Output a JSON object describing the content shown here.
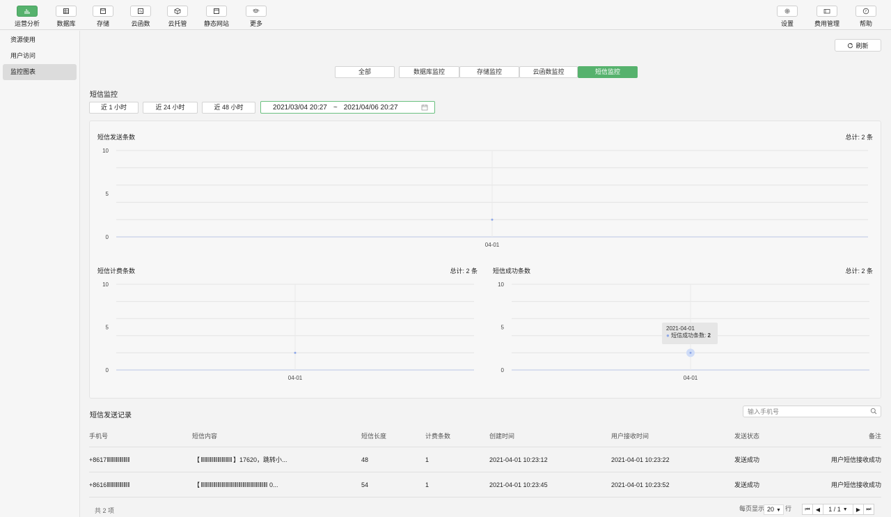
{
  "toolbar": {
    "left": [
      {
        "label": "运营分析",
        "icon": "bar-chart-icon",
        "active": true
      },
      {
        "label": "数据库",
        "icon": "database-icon"
      },
      {
        "label": "存储",
        "icon": "save-icon"
      },
      {
        "label": "云函数",
        "icon": "function-icon"
      },
      {
        "label": "云托管",
        "icon": "cube-icon"
      },
      {
        "label": "静态网站",
        "icon": "browser-icon"
      },
      {
        "label": "更多",
        "icon": "layers-icon"
      }
    ],
    "right": [
      {
        "label": "设置",
        "icon": "gear-icon"
      },
      {
        "label": "费用管理",
        "icon": "wallet-icon"
      },
      {
        "label": "帮助",
        "icon": "help-icon"
      }
    ]
  },
  "sidebar": {
    "items": [
      {
        "label": "资源使用"
      },
      {
        "label": "用户访问"
      },
      {
        "label": "监控图表",
        "active": true
      }
    ]
  },
  "refresh_label": "刷新",
  "tabs": [
    "全部",
    "数据库监控",
    "存储监控",
    "云函数监控",
    "短信监控"
  ],
  "active_tab": "短信监控",
  "section_title": "短信监控",
  "ranges": [
    "近 1 小时",
    "近 24 小时",
    "近 48 小时"
  ],
  "date_range": {
    "start": "2021/03/04 20:27",
    "sep": "~",
    "end": "2021/04/06 20:27"
  },
  "charts": [
    {
      "title": "短信发送条数",
      "total": "总计: 2 条"
    },
    {
      "title": "短信计费条数",
      "total": "总计: 2 条"
    },
    {
      "title": "短信成功条数",
      "total": "总计: 2 条"
    }
  ],
  "chart_data": [
    {
      "type": "line",
      "title": "短信发送条数",
      "x": [
        "04-01"
      ],
      "series": [
        {
          "values": [
            2
          ]
        }
      ],
      "ylim": [
        0,
        10
      ],
      "yticks": [
        0,
        5,
        10
      ],
      "grid": true
    },
    {
      "type": "line",
      "title": "短信计费条数",
      "x": [
        "04-01"
      ],
      "series": [
        {
          "values": [
            2
          ]
        }
      ],
      "ylim": [
        0,
        10
      ],
      "yticks": [
        0,
        5,
        10
      ],
      "grid": true
    },
    {
      "type": "line",
      "title": "短信成功条数",
      "x": [
        "04-01"
      ],
      "series": [
        {
          "name": "短信成功条数",
          "values": [
            2
          ]
        }
      ],
      "ylim": [
        0,
        10
      ],
      "yticks": [
        0,
        5,
        10
      ],
      "grid": true
    }
  ],
  "tooltip": {
    "date": "2021-04-01",
    "label": "短信成功条数: ",
    "value": "2"
  },
  "records_title": "短信发送记录",
  "search_placeholder": "输入手机号",
  "table": {
    "headers": [
      "手机号",
      "短信内容",
      "短信长度",
      "计费条数",
      "创建时间",
      "用户接收时间",
      "发送状态",
      "备注"
    ],
    "rows": [
      {
        "phone": "+8617",
        "content_pre": "【",
        "content_post": "】17620，跳转小...",
        "length": "48",
        "billed": "1",
        "created": "2021-04-01 10:23:12",
        "received": "2021-04-01 10:23:22",
        "status": "发送成功",
        "note": "用户短信接收成功"
      },
      {
        "phone": "+8616",
        "content_pre": "【",
        "content_post": "0...",
        "length": "54",
        "billed": "1",
        "created": "2021-04-01 10:23:45",
        "received": "2021-04-01 10:23:52",
        "status": "发送成功",
        "note": "用户短信接收成功"
      }
    ]
  },
  "footer": {
    "count": "共 2 项",
    "per_page_label": "每页显示",
    "per_page": "20",
    "rows_unit": "行",
    "page": "1 / 1"
  },
  "colors": {
    "accent": "#56b26d",
    "line": "#8fa8e8"
  }
}
